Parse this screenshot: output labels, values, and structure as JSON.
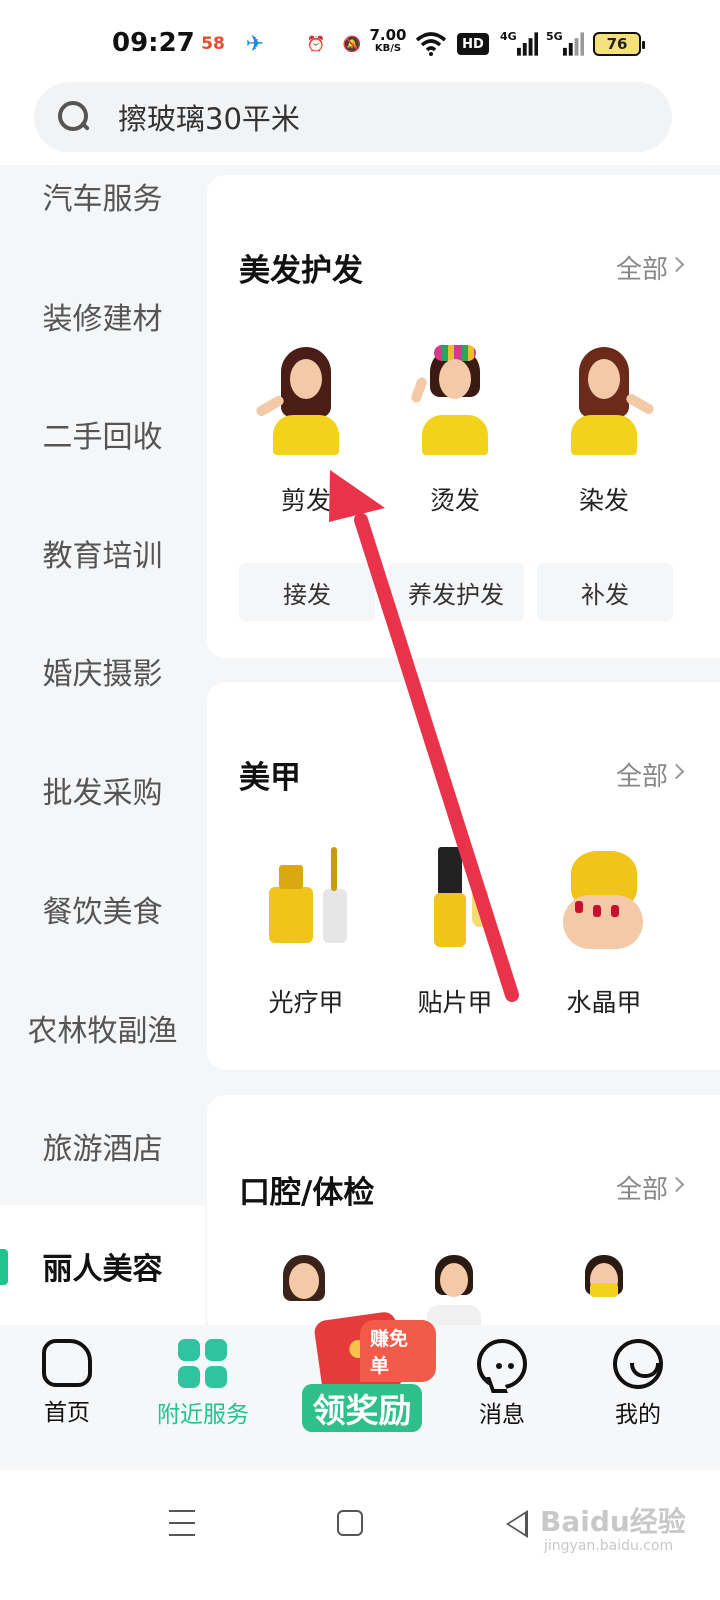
{
  "status_bar": {
    "time": "09:27",
    "app_58": "58",
    "net_speed": "7.00",
    "net_unit": "KB/S",
    "hd_label": "HD",
    "signal_4g": "4G",
    "signal_5g": "5G",
    "battery": "76"
  },
  "search": {
    "query": "擦玻璃30平米"
  },
  "sidebar": {
    "items": [
      {
        "label": "汽车服务"
      },
      {
        "label": "装修建材"
      },
      {
        "label": "二手回收"
      },
      {
        "label": "教育培训"
      },
      {
        "label": "婚庆摄影"
      },
      {
        "label": "批发采购"
      },
      {
        "label": "餐饮美食"
      },
      {
        "label": "农林牧副渔"
      },
      {
        "label": "旅游酒店"
      },
      {
        "label": "丽人美容"
      }
    ],
    "active_index": 9
  },
  "sections": [
    {
      "title": "美发护发",
      "all_label": "全部",
      "items": [
        {
          "label": "剪发",
          "icon": "haircut-icon"
        },
        {
          "label": "烫发",
          "icon": "perm-icon"
        },
        {
          "label": "染发",
          "icon": "hair-dye-icon"
        }
      ],
      "tags": [
        "接发",
        "养发护发",
        "补发"
      ]
    },
    {
      "title": "美甲",
      "all_label": "全部",
      "items": [
        {
          "label": "光疗甲",
          "icon": "gel-nail-icon"
        },
        {
          "label": "贴片甲",
          "icon": "press-on-nail-icon"
        },
        {
          "label": "水晶甲",
          "icon": "crystal-nail-icon"
        }
      ]
    },
    {
      "title": "口腔/体检",
      "all_label": "全部"
    }
  ],
  "bottom_nav": {
    "items": [
      {
        "label": "首页",
        "icon": "home-icon"
      },
      {
        "label": "附近服务",
        "icon": "grid-icon",
        "active": true
      },
      {
        "label": "消息",
        "icon": "message-icon"
      },
      {
        "label": "我的",
        "icon": "profile-icon"
      }
    ],
    "reward": {
      "badge": "赚免单",
      "label": "领奖励"
    }
  },
  "watermark": {
    "brand": "Baidu经验",
    "url": "jingyan.baidu.com"
  },
  "colors": {
    "accent": "#21c48c",
    "annotation_arrow": "#e8334a"
  }
}
